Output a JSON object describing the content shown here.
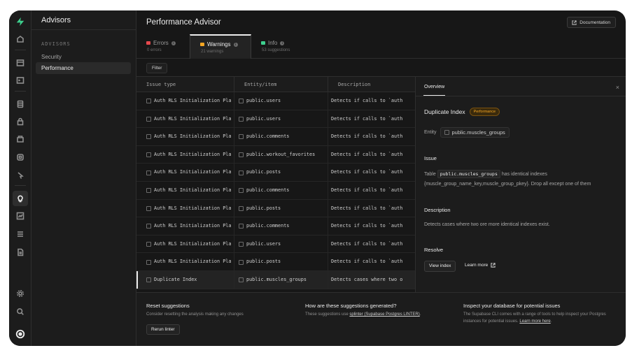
{
  "sidebar": {
    "title": "Advisors",
    "section": "ADVISORS",
    "items": [
      {
        "label": "Security"
      },
      {
        "label": "Performance"
      }
    ]
  },
  "header": {
    "title": "Performance Advisor",
    "doc_button": "Documentation"
  },
  "tabs": [
    {
      "label": "Errors",
      "sub": "0 errors",
      "color": "#e5484d"
    },
    {
      "label": "Warnings",
      "sub": "21 warnings",
      "color": "#f5a623"
    },
    {
      "label": "Info",
      "sub": "53 suggestions",
      "color": "#3ecf8e"
    }
  ],
  "filter_label": "Filter",
  "table": {
    "columns": [
      "Issue type",
      "Entity/item",
      "Description"
    ],
    "rows": [
      {
        "type": "Auth RLS Initialization Pla",
        "entity": "public.users",
        "desc": "Detects if calls to `auth"
      },
      {
        "type": "Auth RLS Initialization Pla",
        "entity": "public.users",
        "desc": "Detects if calls to `auth"
      },
      {
        "type": "Auth RLS Initialization Pla",
        "entity": "public.comments",
        "desc": "Detects if calls to `auth"
      },
      {
        "type": "Auth RLS Initialization Pla",
        "entity": "public.workout_favorites",
        "desc": "Detects if calls to `auth"
      },
      {
        "type": "Auth RLS Initialization Pla",
        "entity": "public.posts",
        "desc": "Detects if calls to `auth"
      },
      {
        "type": "Auth RLS Initialization Pla",
        "entity": "public.comments",
        "desc": "Detects if calls to `auth"
      },
      {
        "type": "Auth RLS Initialization Pla",
        "entity": "public.posts",
        "desc": "Detects if calls to `auth"
      },
      {
        "type": "Auth RLS Initialization Pla",
        "entity": "public.comments",
        "desc": "Detects if calls to `auth"
      },
      {
        "type": "Auth RLS Initialization Pla",
        "entity": "public.users",
        "desc": "Detects if calls to `auth"
      },
      {
        "type": "Auth RLS Initialization Pla",
        "entity": "public.posts",
        "desc": "Detects if calls to `auth"
      },
      {
        "type": "Duplicate Index",
        "entity": "public.muscles_groups",
        "desc": "Detects cases where two o"
      }
    ]
  },
  "panel": {
    "tab": "Overview",
    "close": "×",
    "title": "Duplicate Index",
    "badge": "Performance",
    "entity_label": "Entity",
    "entity_value": "public.muscles_groups",
    "issue_label": "Issue",
    "issue_pre": "Table",
    "issue_code": "public.muscles_groups",
    "issue_post": "has identical indexes",
    "issue_line2": "{muscle_group_name_key,muscle_group_pkey}. Drop all except one of them",
    "description_label": "Description",
    "description_text": "Detects cases where two ore more identical indexes exist.",
    "resolve_label": "Resolve",
    "view_button": "View index",
    "learn_more": "Learn more"
  },
  "footer": {
    "reset_title": "Reset suggestions",
    "reset_text": "Consider resetting the analysis making any changes",
    "rerun_button": "Rerun linter",
    "how_title": "How are these suggestions generated?",
    "how_text": "These suggestions use",
    "how_link": "splinter (Supabase Postgres LINTER)",
    "how_end": ".",
    "inspect_title": "Inspect your database for potential issues",
    "inspect_text": "The Supabase CLI comes with a range of tools to help inspect your Postgres instances for potential issues.",
    "inspect_link": "Learn more here",
    "inspect_end": "."
  },
  "colors": {
    "brand": "#3ecf8e",
    "badge": "#f5a623"
  }
}
